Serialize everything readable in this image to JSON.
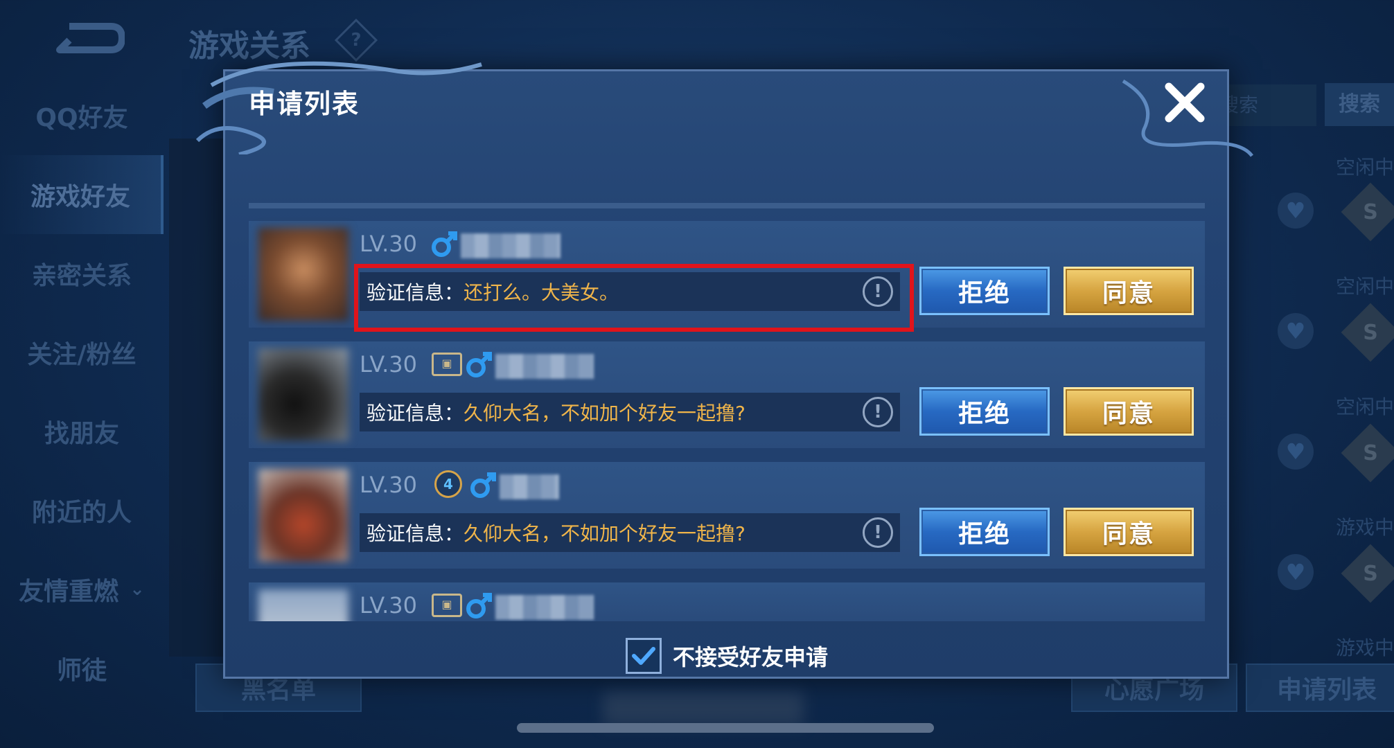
{
  "background": {
    "title": "游戏关系",
    "help_glyph": "?",
    "nav_items": [
      {
        "label": "QQ好友"
      },
      {
        "label": "游戏好友"
      },
      {
        "label": "亲密关系"
      },
      {
        "label": "关注/粉丝"
      },
      {
        "label": "找朋友"
      },
      {
        "label": "附近的人"
      },
      {
        "label": "友情重燃"
      },
      {
        "label": "师徒"
      }
    ],
    "nav_chevron": "⌄",
    "search_placeholder": "搜索",
    "search_button": "搜索",
    "statuses": [
      "空闲中",
      "空闲中",
      "空闲中",
      "游戏中",
      "游戏中"
    ],
    "coin_glyph": "S",
    "heart_glyph": "♥",
    "bottom_buttons": {
      "blacklist": "黑名单",
      "wish_square": "心愿广场",
      "requests": "申请列表"
    }
  },
  "dialog": {
    "title": "申请列表",
    "rows": [
      {
        "level": "LV.30",
        "message_label": "验证信息：",
        "message": "还打么。大美女。",
        "reject": "拒绝",
        "accept": "同意"
      },
      {
        "level": "LV.30",
        "message_label": "验证信息：",
        "message": "久仰大名，不如加个好友一起撸?",
        "reject": "拒绝",
        "accept": "同意"
      },
      {
        "level": "LV.30",
        "rank_badge": "4",
        "message_label": "验证信息：",
        "message": "久仰大名，不如加个好友一起撸?",
        "reject": "拒绝",
        "accept": "同意"
      },
      {
        "level": "LV.30"
      }
    ],
    "info_glyph": "!",
    "footer_checkbox": {
      "label": "不接受好友申请",
      "checked": true
    }
  },
  "colors": {
    "reject_blue": "#2769c2",
    "accept_gold": "#d6a441",
    "message_orange": "#f0b54a",
    "highlight_red": "#e0141b"
  }
}
